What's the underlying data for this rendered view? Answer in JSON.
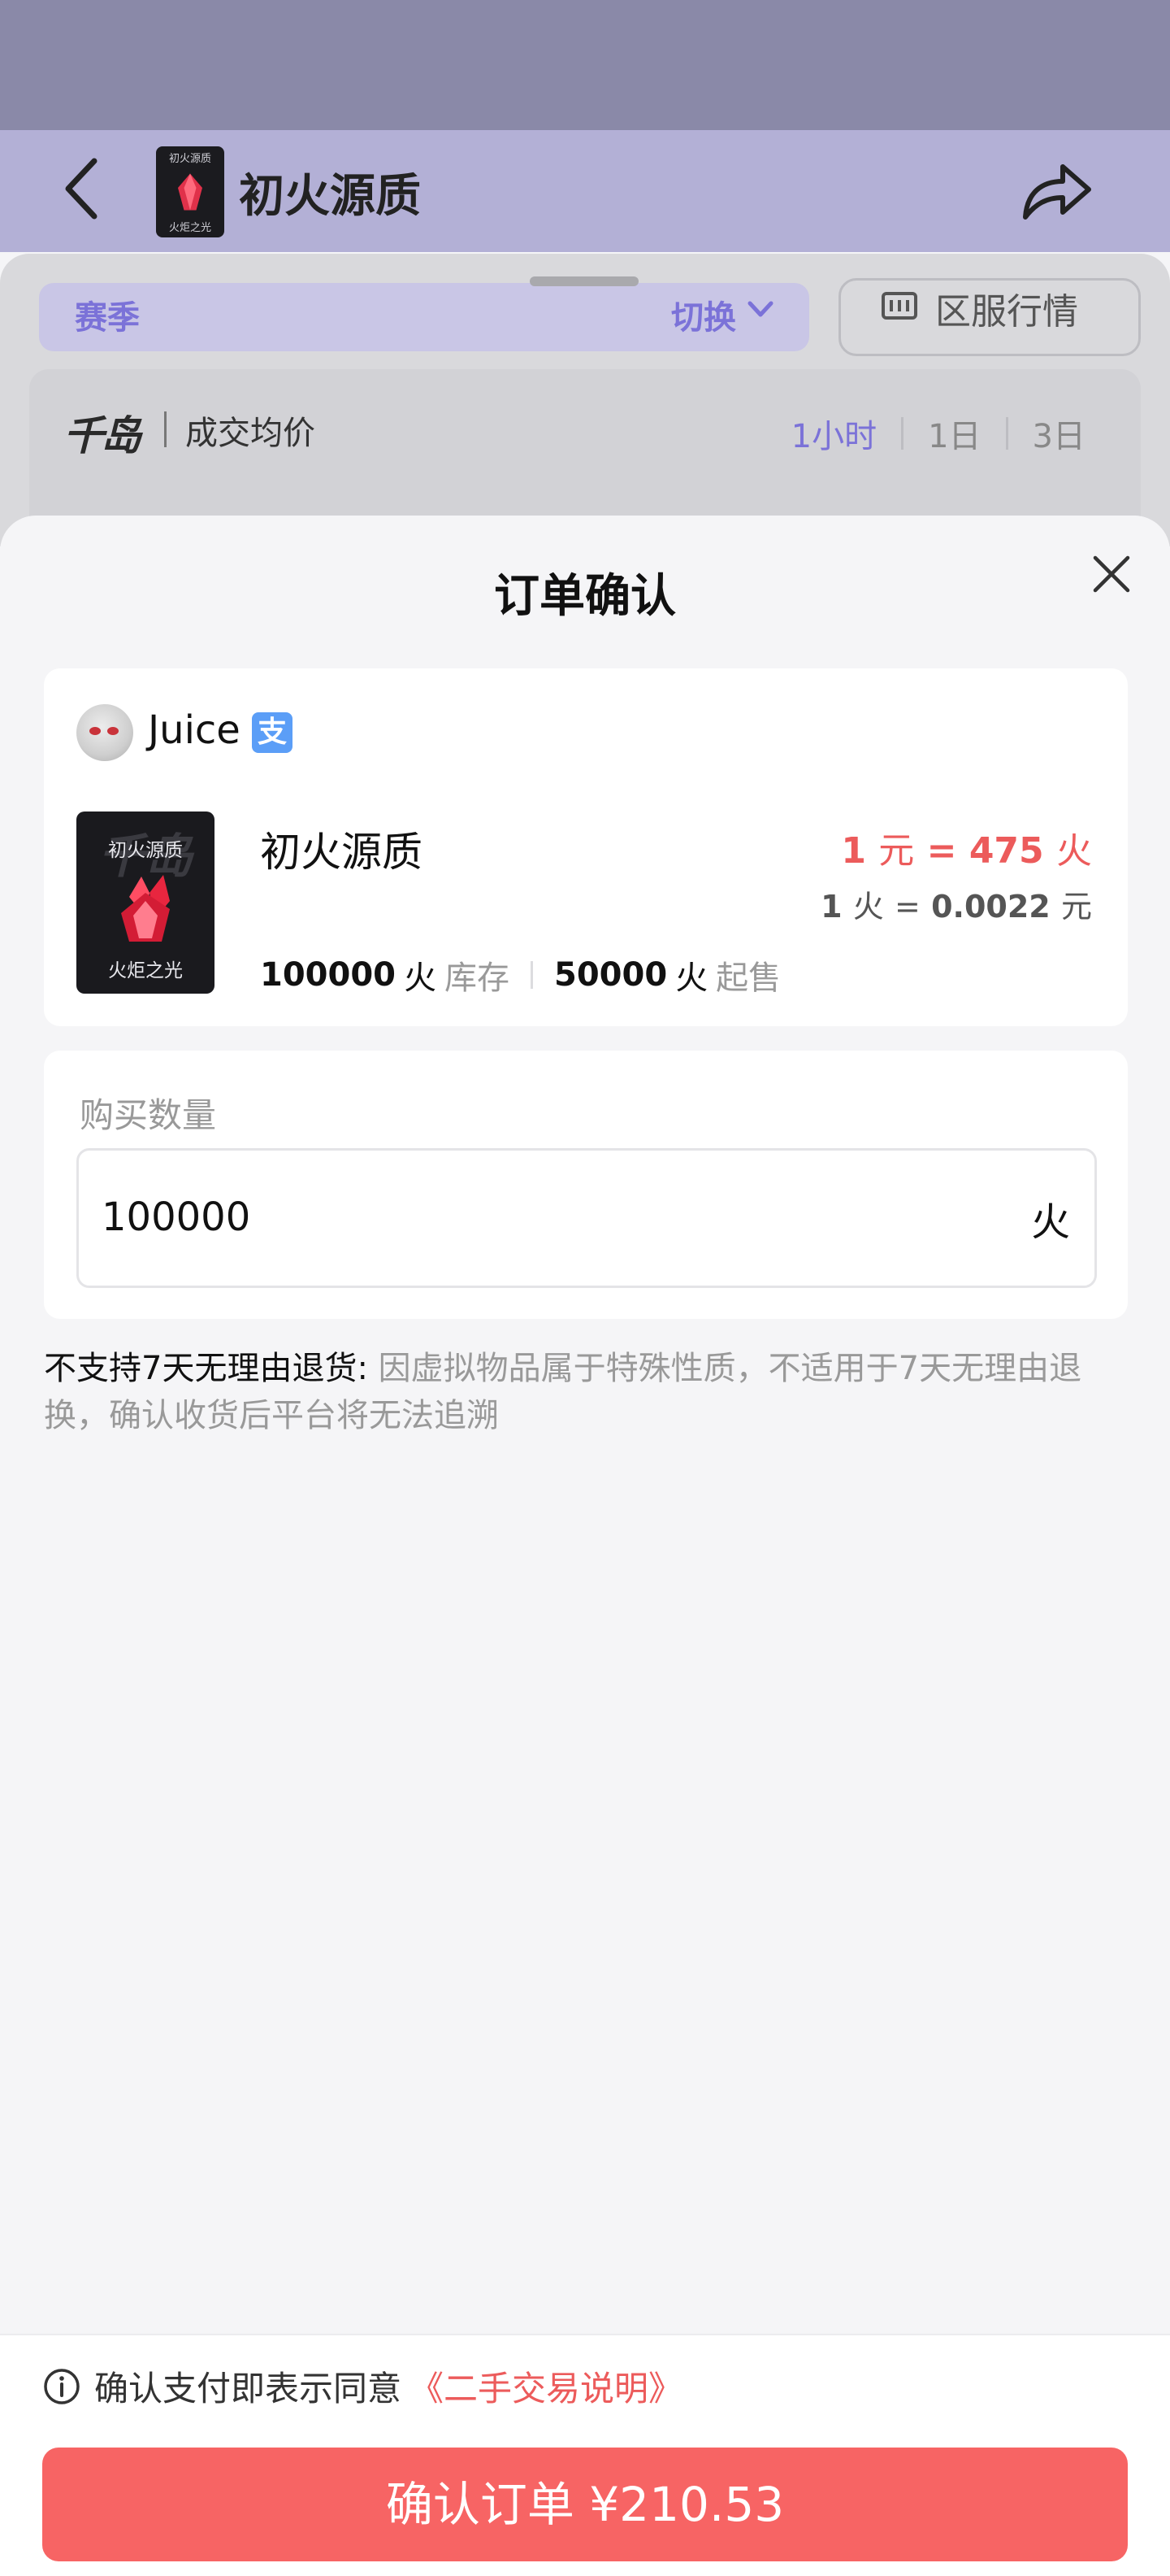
{
  "header": {
    "title": "初火源质",
    "thumb_top": "初火源质",
    "thumb_bottom": "火炬之光",
    "back_icon": "chevron-left-icon",
    "share_icon": "share-arrow-icon"
  },
  "background": {
    "season_label": "赛季",
    "switch_label": "切换",
    "region_button": "区服行情",
    "logo": "千岛",
    "avg_price_label": "成交均价",
    "ranges": [
      "1小时",
      "1日",
      "3日"
    ],
    "active_range": "1小时"
  },
  "sheet": {
    "title": "订单确认",
    "close_icon": "close-icon",
    "seller": {
      "name": "Juice",
      "pay_badge": "支"
    },
    "item": {
      "name": "初火源质",
      "thumb_watermark": "千岛",
      "thumb_top": "初火源质",
      "thumb_bottom": "火炬之光",
      "rate1_num": "1",
      "rate1_unit": "元",
      "rate1_eq": "=",
      "rate1_val": "475",
      "rate1_val_unit": "火",
      "rate2_num": "1",
      "rate2_unit": "火",
      "rate2_eq": "=",
      "rate2_val": "0.0022",
      "rate2_val_unit": "元",
      "stock_num": "100000",
      "stock_unit": "火",
      "stock_label": "库存",
      "min_num": "50000",
      "min_unit": "火",
      "min_label": "起售"
    },
    "quantity": {
      "label": "购买数量",
      "value": "100000",
      "unit": "火"
    },
    "notice": {
      "strong": "不支持7天无理由退货:",
      "text": " 因虚拟物品属于特殊性质，不适用于7天无理由退换，确认收货后平台将无法追溯"
    }
  },
  "footer": {
    "agree_text": "确认支付即表示同意",
    "agree_link": "《二手交易说明》",
    "confirm_label": "确认订单 ¥210.53"
  },
  "colors": {
    "accent_red": "#f76464",
    "price_red": "#ec5b5b",
    "header_purple": "#b3b0d6",
    "accent_purple": "#7b72d8"
  }
}
